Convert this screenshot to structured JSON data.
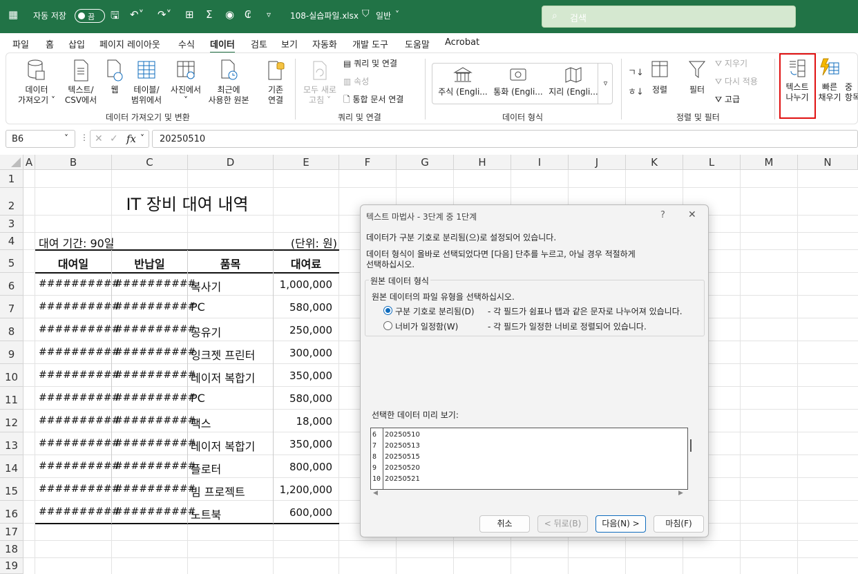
{
  "titlebar": {
    "autosave_label": "자동 저장",
    "autosave_state": "끔",
    "filename": "108-실습파일.xlsx",
    "sensitivity": "일반",
    "search_placeholder": "검색"
  },
  "menu": [
    "파일",
    "홈",
    "삽입",
    "페이지 레이아웃",
    "수식",
    "데이터",
    "검토",
    "보기",
    "자동화",
    "개발 도구",
    "도움말",
    "Acrobat"
  ],
  "ribbon": {
    "get_data_1": "데이터",
    "get_data_2": "가져오기 ˅",
    "text_csv_1": "텍스트/",
    "text_csv_2": "CSV에서",
    "web": "웹",
    "table_range_1": "테이블/",
    "table_range_2": "범위에서",
    "from_picture_1": "사진에서",
    "from_picture_2": "˅",
    "recent_sources_1": "최근에",
    "recent_sources_2": "사용한 원본",
    "existing_conn_1": "기존",
    "existing_conn_2": "연결",
    "group_get_transform": "데이터 가져오기 및 변환",
    "refresh_all_1": "모두 새로",
    "refresh_all_2": "고침 ˅",
    "queries_connections": "쿼리 및 연결",
    "properties": "속성",
    "edit_links": "통합 문서 연결",
    "group_queries": "쿼리 및 연결",
    "stocks": "주식 (Engli...",
    "currencies": "통화 (Engli...",
    "geography": "지리 (Engli...",
    "group_data_types": "데이터 형식",
    "sort": "정렬",
    "filter": "필터",
    "clear": "지우기",
    "reapply": "다시 적용",
    "advanced": "고급",
    "group_sort_filter": "정렬 및 필터",
    "text_to_columns_1": "텍스트",
    "text_to_columns_2": "나누기",
    "flash_fill_1": "빠른",
    "flash_fill_2": "채우기",
    "remove_dup_1": "중",
    "remove_dup_2": "항목"
  },
  "formula_bar": {
    "name_box": "B6",
    "fx": "fx",
    "value": "20250510"
  },
  "columns": [
    "A",
    "B",
    "C",
    "D",
    "E",
    "F",
    "G",
    "H",
    "I",
    "J",
    "K",
    "L",
    "M",
    "N"
  ],
  "rows": [
    "1",
    "2",
    "3",
    "4",
    "5",
    "6",
    "7",
    "8",
    "9",
    "10",
    "11",
    "12",
    "13",
    "14",
    "15",
    "16",
    "17",
    "18",
    "19"
  ],
  "sheet": {
    "title": "IT 장비 대여 내역",
    "period": "대여 기간: 90일",
    "unit": "(단위: 원)",
    "headers": [
      "대여일",
      "반납일",
      "품목",
      "대여료"
    ],
    "data": [
      [
        "##########",
        "##########",
        "복사기",
        "1,000,000"
      ],
      [
        "##########",
        "##########",
        "PC",
        "580,000"
      ],
      [
        "##########",
        "##########",
        "공유기",
        "250,000"
      ],
      [
        "##########",
        "##########",
        "잉크젯 프린터",
        "300,000"
      ],
      [
        "##########",
        "##########",
        "레이저 복합기",
        "350,000"
      ],
      [
        "##########",
        "##########",
        "PC",
        "580,000"
      ],
      [
        "##########",
        "##########",
        "팩스",
        "18,000"
      ],
      [
        "##########",
        "##########",
        "레이저 복합기",
        "350,000"
      ],
      [
        "##########",
        "##########",
        "플로터",
        "800,000"
      ],
      [
        "##########",
        "##########",
        "빔 프로젝트",
        "1,200,000"
      ],
      [
        "##########",
        "##########",
        "노트북",
        "600,000"
      ]
    ]
  },
  "dialog": {
    "title": "텍스트 마법사 - 3단계 중 1단계",
    "help": "?",
    "close": "✕",
    "line1": "데이터가 구분 기호로 분리됨(으)로 설정되어 있습니다.",
    "line2": "데이터 형식이 올바로 선택되었다면 [다음] 단추를 누르고, 아닐 경우 적절하게",
    "line3": "선택하십시오.",
    "group_label": "원본 데이터 형식",
    "group_prompt": "원본 데이터의 파일 유형을 선택하십시오.",
    "opt1_label": "구분 기호로 분리됨(D)",
    "opt1_desc": "- 각 필드가 쉼표나 탭과 같은 문자로 나누어져 있습니다.",
    "opt2_label": "너비가 일정함(W)",
    "opt2_desc": "- 각 필드가 일정한 너비로 정렬되어 있습니다.",
    "preview_label": "선택한 데이터 미리 보기:",
    "preview": [
      {
        "n": "6",
        "v": "20250510"
      },
      {
        "n": "7",
        "v": "20250513"
      },
      {
        "n": "8",
        "v": "20250515"
      },
      {
        "n": "9",
        "v": "20250520"
      },
      {
        "n": "10",
        "v": "20250521"
      }
    ],
    "cancel": "취소",
    "back": "< 뒤로(B)",
    "next": "다음(N) >",
    "finish": "마침(F)"
  },
  "colors": {
    "excel_green": "#217346",
    "highlight_red": "#e01010",
    "radio_blue": "#0f6cbd"
  }
}
